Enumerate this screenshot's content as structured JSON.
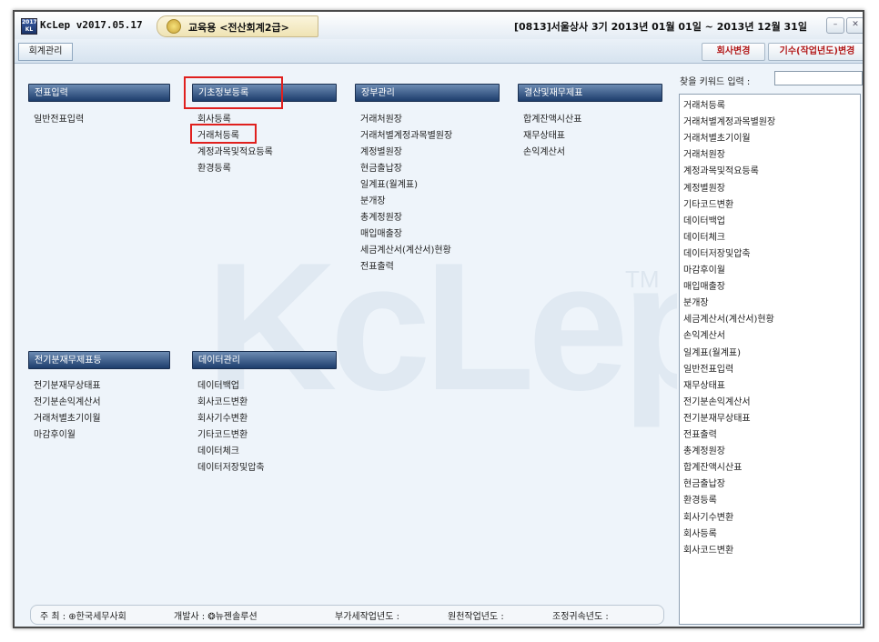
{
  "titlebar": {
    "logo_text": "2017 KL",
    "app_title": "KcLep v2017.05.17",
    "edu_label": "교육용 <전산회계2급>",
    "company_info": "[0813]서울상사 3기 2013년 01월 01일 ~ 2013년 12월 31일",
    "minimize_glyph": "–",
    "close_glyph": "✕"
  },
  "subbar": {
    "tab_label": "회계관리",
    "change_company": "회사변경",
    "change_period": "기수(작업년도)변경"
  },
  "sections": {
    "voucher": {
      "title": "전표입력",
      "items": [
        "일반전표입력"
      ]
    },
    "basic": {
      "title": "기초정보등록",
      "items": [
        "회사등록",
        "거래처등록",
        "계정과목및적요등록",
        "환경등록"
      ]
    },
    "ledger": {
      "title": "장부관리",
      "items": [
        "거래처원장",
        "거래처별계정과목별원장",
        "계정별원장",
        "현금출납장",
        "일계표(월계표)",
        "분개장",
        "총계정원장",
        "매입매출장",
        "세금계산서(계산서)현황",
        "전표출력"
      ]
    },
    "closing": {
      "title": "결산및재무제표",
      "items": [
        "합계잔액시산표",
        "재무상태표",
        "손익계산서"
      ]
    },
    "prior": {
      "title": "전기분재무제표등",
      "items": [
        "전기분재무상태표",
        "전기분손익계산서",
        "거래처별초기이월",
        "마감후이월"
      ]
    },
    "data": {
      "title": "데이터관리",
      "items": [
        "데이터백업",
        "회사코드변환",
        "회사기수변환",
        "기타코드변환",
        "데이터체크",
        "데이터저장및압축"
      ]
    }
  },
  "watermark": {
    "text": "KcLep",
    "tm": "TM"
  },
  "footer": {
    "host": "주 최 : ⊕한국세무사회",
    "developer": "개발사 : ❂뉴젠솔루션",
    "vat_year": "부가세작업년도 :",
    "withholding_year": "원천작업년도 :",
    "adjust_year": "조정귀속년도 :"
  },
  "keyword": {
    "label": "찾을 키워드 입력 :",
    "value": "",
    "items": [
      "거래처등록",
      "거래처별계정과목별원장",
      "거래처별초기이월",
      "거래처원장",
      "계정과목및적요등록",
      "계정별원장",
      "기타코드변환",
      "데이터백업",
      "데이터체크",
      "데이터저장및압축",
      "마감후이월",
      "매입매출장",
      "분개장",
      "세금계산서(계산서)현황",
      "손익계산서",
      "일계표(월계표)",
      "일반전표입력",
      "재무상태표",
      "전기분손익계산서",
      "전기분재무상태표",
      "전표출력",
      "총계정원장",
      "합계잔액시산표",
      "현금출납장",
      "환경등록",
      "회사기수변환",
      "회사등록",
      "회사코드변환"
    ]
  },
  "colors": {
    "section_head": "#1d3d6c",
    "highlight": "#e0201e",
    "sub_button_text": "#b31b1b"
  }
}
